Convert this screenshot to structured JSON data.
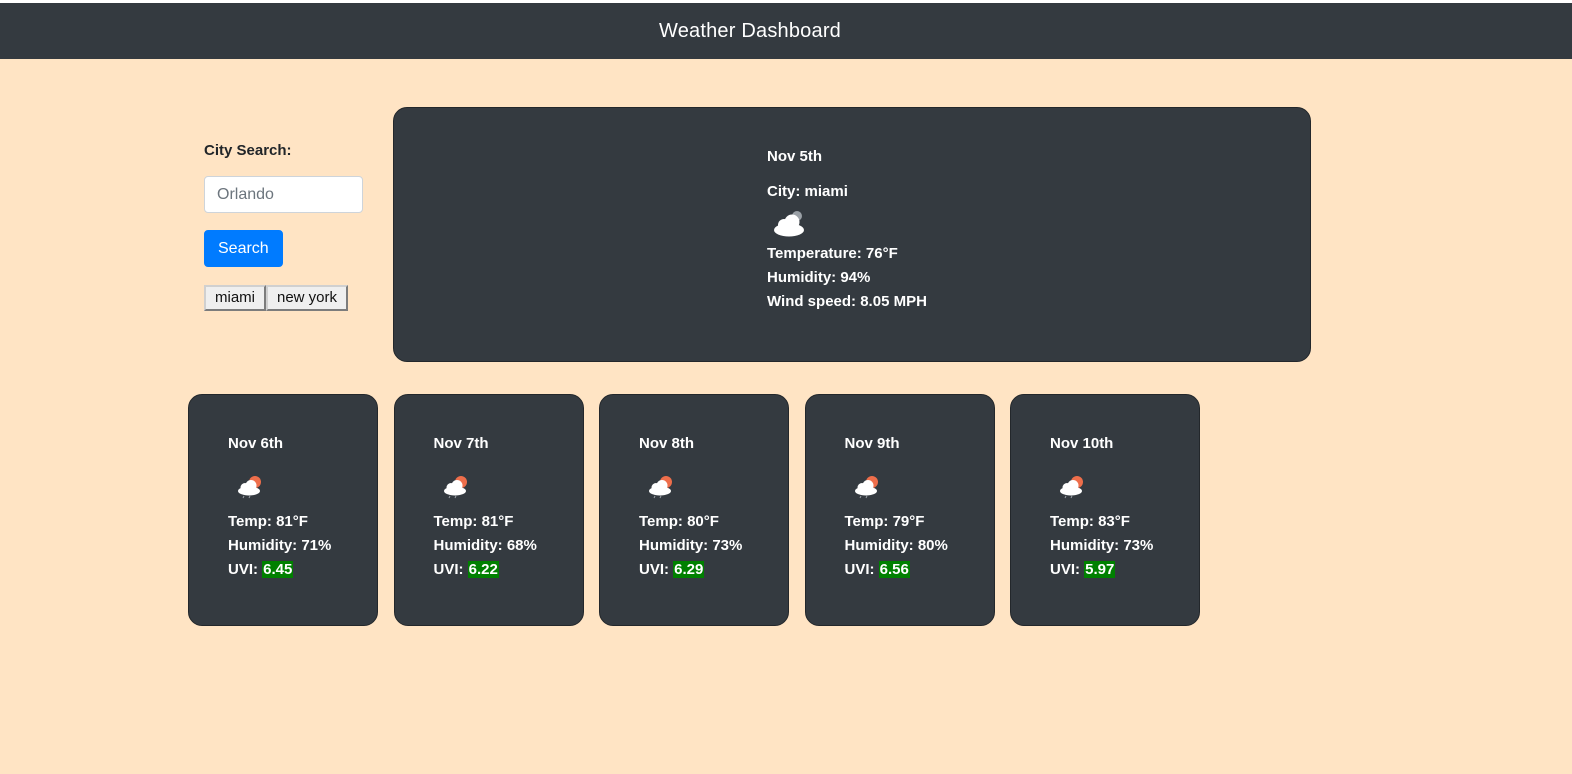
{
  "header": {
    "title": "Weather Dashboard"
  },
  "search": {
    "label": "City Search:",
    "placeholder": "Orlando",
    "button_label": "Search",
    "history": [
      "miami",
      "new york"
    ]
  },
  "current": {
    "date": "Nov 5th",
    "city_label": "City:",
    "city": "miami",
    "icon": "cloud-icon",
    "temperature_label": "Temperature:",
    "temperature": "76°F",
    "humidity_label": "Humidity:",
    "humidity": "94%",
    "wind_label": "Wind speed:",
    "wind": "8.05 MPH"
  },
  "forecast_labels": {
    "temp": "Temp:",
    "humidity": "Humidity:",
    "uvi": "UVI:"
  },
  "forecast": [
    {
      "date": "Nov 6th",
      "icon": "cloud-sun-icon",
      "temp": "81°F",
      "humidity": "71%",
      "uvi": "6.45"
    },
    {
      "date": "Nov 7th",
      "icon": "cloud-sun-icon",
      "temp": "81°F",
      "humidity": "68%",
      "uvi": "6.22"
    },
    {
      "date": "Nov 8th",
      "icon": "cloud-sun-icon",
      "temp": "80°F",
      "humidity": "73%",
      "uvi": "6.29"
    },
    {
      "date": "Nov 9th",
      "icon": "cloud-sun-icon",
      "temp": "79°F",
      "humidity": "80%",
      "uvi": "6.56"
    },
    {
      "date": "Nov 10th",
      "icon": "cloud-sun-icon",
      "temp": "83°F",
      "humidity": "73%",
      "uvi": "5.97"
    }
  ],
  "colors": {
    "page_background": "#ffe4c4",
    "card_background": "#343a40",
    "accent": "#007bff",
    "uvi_badge": "#008000",
    "sun": "#ee6e4b"
  }
}
